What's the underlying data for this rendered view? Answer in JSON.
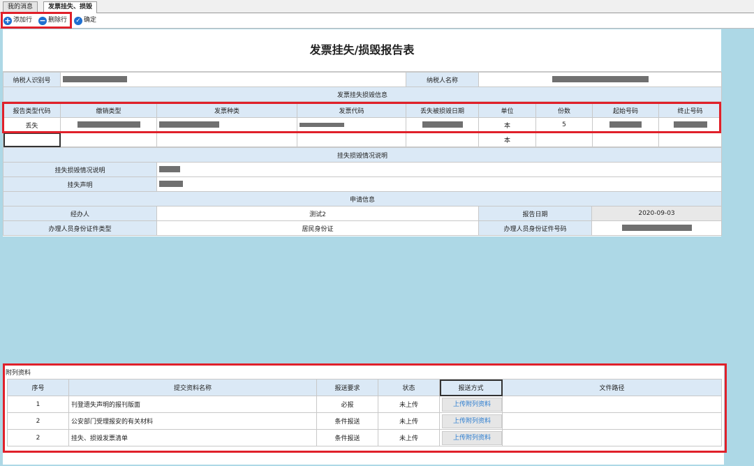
{
  "tabs": [
    {
      "label": "我的消息",
      "active": false
    },
    {
      "label": "发票挂失、损毁",
      "active": true
    }
  ],
  "toolbar": {
    "add_row": "添加行",
    "delete_row": "删除行",
    "confirm": "确定"
  },
  "form": {
    "title": "发票挂失/损毁报告表",
    "taxpayer_id_label": "纳税人识别号",
    "taxpayer_name_label": "纳税人名称",
    "section_invoice": "发票挂失损毁信息",
    "invoice_headers": [
      "报告类型代码",
      "缴销类型",
      "发票种类",
      "发票代码",
      "丢失被损毁日期",
      "单位",
      "份数",
      "起始号码",
      "终止号码"
    ],
    "invoice_rows": [
      {
        "type": "丢失",
        "unit": "本",
        "count": "5"
      },
      {
        "type": "",
        "unit": "本",
        "count": ""
      }
    ],
    "section_explain": "挂失损毁情况说明",
    "explain_label": "挂失损毁情况说明",
    "statement_label": "挂失声明",
    "section_apply": "申请信息",
    "handler_label": "经办人",
    "handler_value": "测试2",
    "report_date_label": "报告日期",
    "report_date_value": "2020-09-03",
    "id_type_label": "办理人员身份证件类型",
    "id_type_value": "居民身份证",
    "id_number_label": "办理人员身份证件号码"
  },
  "attachments": {
    "title": "附列资料",
    "headers": [
      "序号",
      "提交资料名称",
      "报送要求",
      "状态",
      "报送方式",
      "文件路径"
    ],
    "rows": [
      {
        "no": "1",
        "name": "刊登遗失声明的报刊版面",
        "req": "必报",
        "status": "未上传",
        "action": "上传附列资料"
      },
      {
        "no": "2",
        "name": "公安部门受理报安的有关材料",
        "req": "条件报送",
        "status": "未上传",
        "action": "上传附列资料"
      },
      {
        "no": "2",
        "name": "挂失、损毁发票清单",
        "req": "条件报送",
        "status": "未上传",
        "action": "上传附列资料"
      }
    ]
  },
  "colors": {
    "highlight": "#e0202a",
    "background": "#add8e6",
    "label_bg": "#dbe9f6",
    "link": "#2a7cd0"
  }
}
